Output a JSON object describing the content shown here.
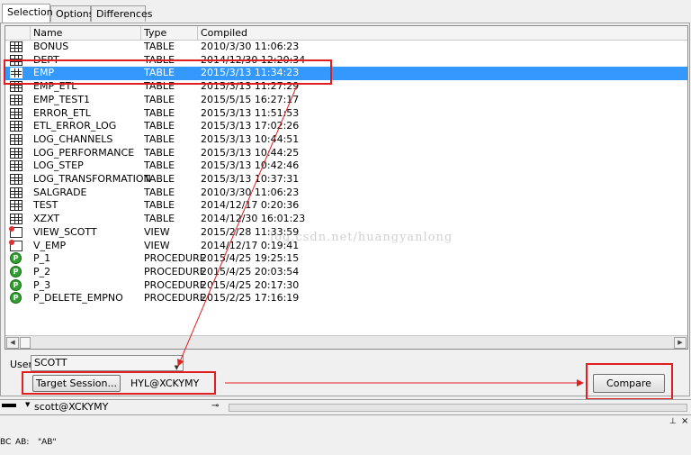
{
  "tabs": [
    "Selection",
    "Options",
    "Differences"
  ],
  "grid": {
    "columns": [
      "Name",
      "Type",
      "Compiled"
    ],
    "selected_index": 2,
    "rows": [
      {
        "icon": "table-icon",
        "name": "BONUS",
        "type": "TABLE",
        "compiled": "2010/3/30 11:06:23"
      },
      {
        "icon": "table-icon",
        "name": "DEPT",
        "type": "TABLE",
        "compiled": "2014/12/30 12:20:34"
      },
      {
        "icon": "table-icon",
        "name": "EMP",
        "type": "TABLE",
        "compiled": "2015/3/13 11:34:23"
      },
      {
        "icon": "table-icon",
        "name": "EMP_ETL",
        "type": "TABLE",
        "compiled": "2015/3/13 11:27:29"
      },
      {
        "icon": "table-icon",
        "name": "EMP_TEST1",
        "type": "TABLE",
        "compiled": "2015/5/15 16:27:17"
      },
      {
        "icon": "table-icon",
        "name": "ERROR_ETL",
        "type": "TABLE",
        "compiled": "2015/3/13 11:51:53"
      },
      {
        "icon": "table-icon",
        "name": "ETL_ERROR_LOG",
        "type": "TABLE",
        "compiled": "2015/3/13 17:02:26"
      },
      {
        "icon": "table-icon",
        "name": "LOG_CHANNELS",
        "type": "TABLE",
        "compiled": "2015/3/13 10:44:51"
      },
      {
        "icon": "table-icon",
        "name": "LOG_PERFORMANCE",
        "type": "TABLE",
        "compiled": "2015/3/13 10:44:25"
      },
      {
        "icon": "table-icon",
        "name": "LOG_STEP",
        "type": "TABLE",
        "compiled": "2015/3/13 10:42:46"
      },
      {
        "icon": "table-icon",
        "name": "LOG_TRANSFORMATION",
        "type": "TABLE",
        "compiled": "2015/3/13 10:37:31"
      },
      {
        "icon": "table-icon",
        "name": "SALGRADE",
        "type": "TABLE",
        "compiled": "2010/3/30 11:06:23"
      },
      {
        "icon": "table-icon",
        "name": "TEST",
        "type": "TABLE",
        "compiled": "2014/12/17 0:20:36"
      },
      {
        "icon": "table-icon",
        "name": "XZXT",
        "type": "TABLE",
        "compiled": "2014/12/30 16:01:23"
      },
      {
        "icon": "view-icon",
        "name": "VIEW_SCOTT",
        "type": "VIEW",
        "compiled": "2015/2/28 11:33:59"
      },
      {
        "icon": "view-icon",
        "name": "V_EMP",
        "type": "VIEW",
        "compiled": "2014/12/17 0:19:41"
      },
      {
        "icon": "procedure-icon",
        "name": "P_1",
        "type": "PROCEDURE",
        "compiled": "2015/4/25 19:25:15"
      },
      {
        "icon": "procedure-icon",
        "name": "P_2",
        "type": "PROCEDURE",
        "compiled": "2015/4/25 20:03:54"
      },
      {
        "icon": "procedure-icon",
        "name": "P_3",
        "type": "PROCEDURE",
        "compiled": "2015/4/25 20:17:30"
      },
      {
        "icon": "procedure-icon",
        "name": "P_DELETE_EMPNO",
        "type": "PROCEDURE",
        "compiled": "2015/2/25 17:16:19"
      }
    ]
  },
  "user": {
    "label": "User",
    "value": "SCOTT"
  },
  "target": {
    "button_label": "Target Session...",
    "value": "HYL@XCKYMY"
  },
  "compare": {
    "button_label": "Compare"
  },
  "status": {
    "connection": "scott@XCKYMY"
  },
  "toolbar_bottom": {
    "item1": "BC",
    "item2": "AB:",
    "item3": "\"AB\""
  },
  "watermark": "log.csdn.net/huangyanlong",
  "colors": {
    "selection": "#3399ff",
    "annotation": "#e02020"
  }
}
